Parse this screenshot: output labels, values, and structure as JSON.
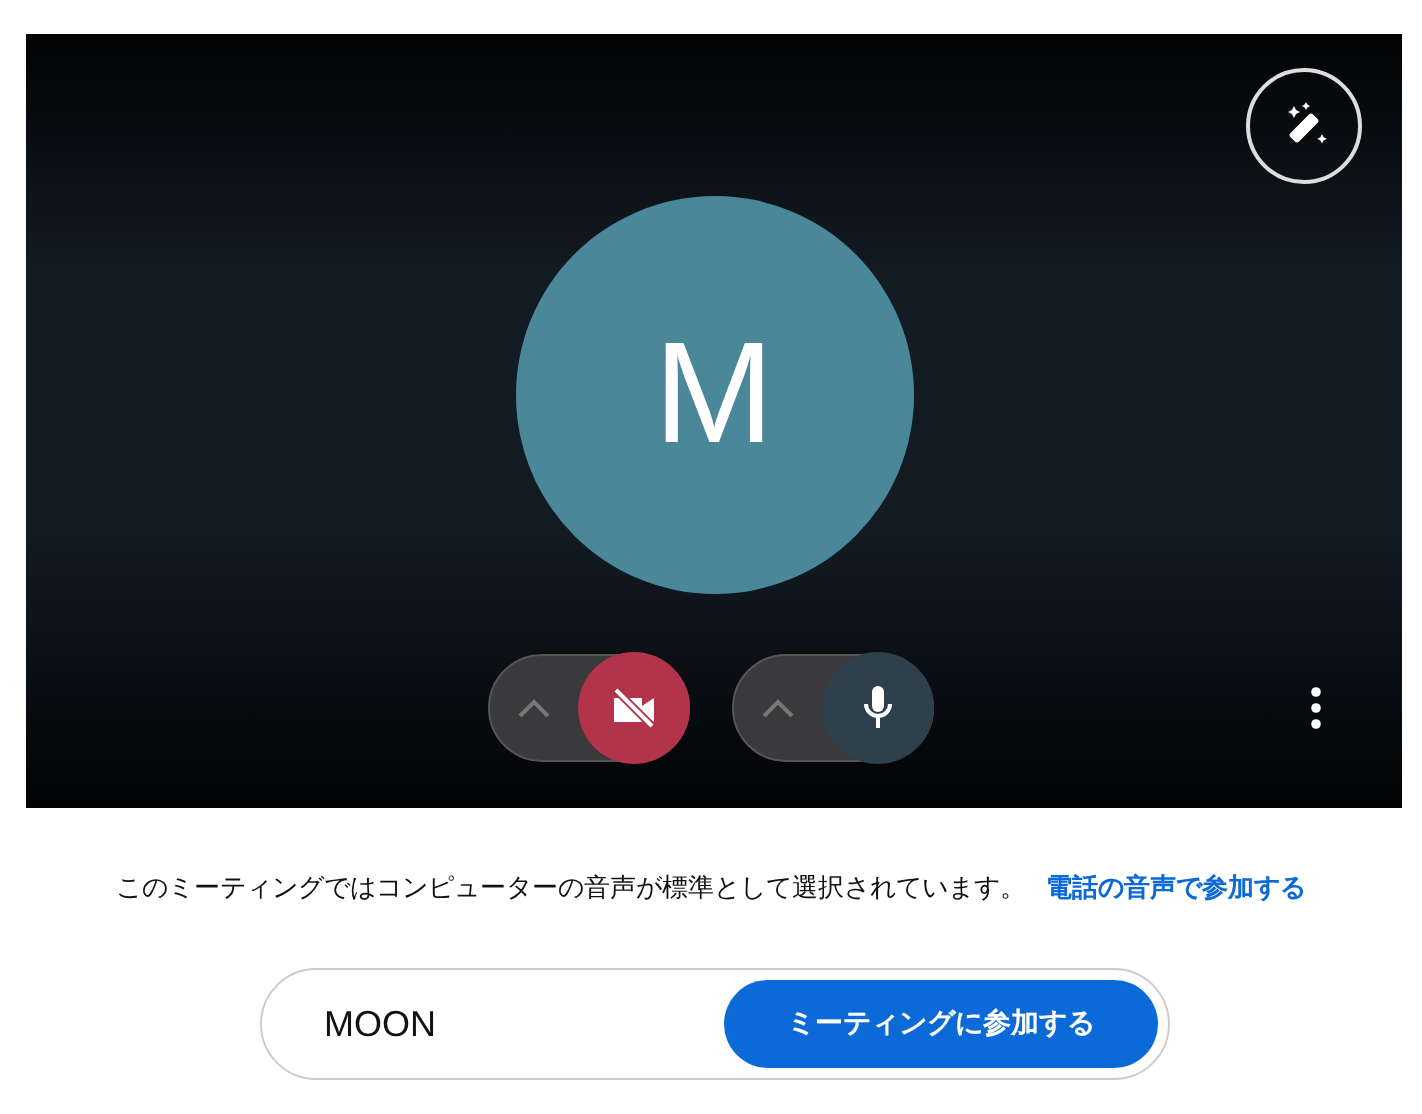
{
  "preview": {
    "avatar_initial": "M",
    "camera": {
      "on": false
    },
    "microphone": {
      "on": true
    }
  },
  "notice": {
    "text": "このミーティングではコンピューターの音声が標準として選択されています。",
    "link": "電話の音声で参加する"
  },
  "join": {
    "name_value": "MOON",
    "button": "ミーティングに参加する"
  }
}
